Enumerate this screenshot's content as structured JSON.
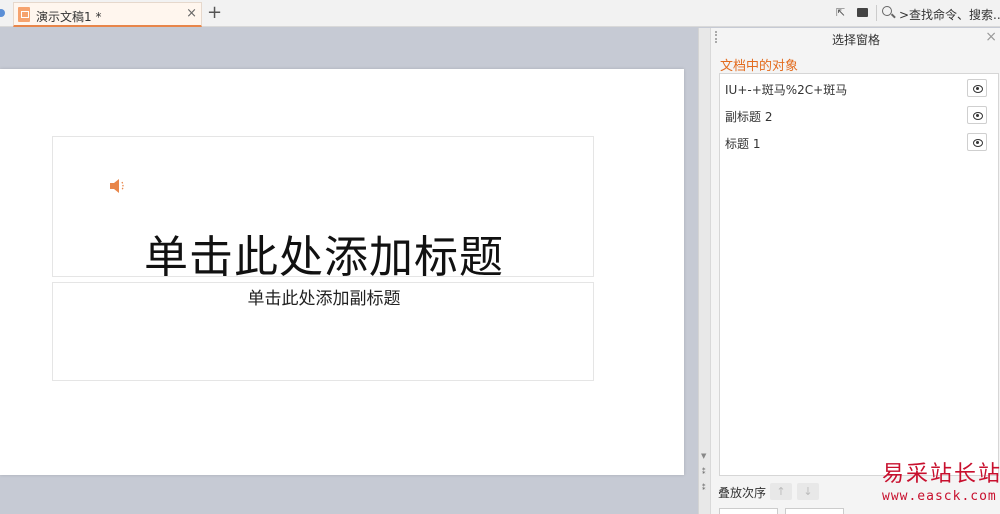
{
  "tabbar": {
    "tab_title": "演示文稿1 *",
    "close_glyph": "×",
    "new_tab_glyph": "+",
    "search_text": ">查找命令、搜索..."
  },
  "slide": {
    "title": "单击此处添加标题",
    "subtitle": "单击此处添加副标题",
    "audio_icon": "speaker-icon"
  },
  "pane": {
    "title": "选择窗格",
    "close_glyph": "×",
    "heading": "文档中的对象",
    "objects": [
      {
        "label": "IU+-+斑马%2C+斑马"
      },
      {
        "label": "副标题 2"
      },
      {
        "label": "标题 1"
      }
    ],
    "order_label": "叠放次序",
    "order_up_glyph": "↑",
    "order_down_glyph": "↓"
  },
  "watermark": {
    "cn": "易采站长站",
    "en": "www.easck.com"
  },
  "colors": {
    "accent": "#e36c1e",
    "watermark": "#c8102e",
    "canvas_bg": "#c6cad4"
  }
}
